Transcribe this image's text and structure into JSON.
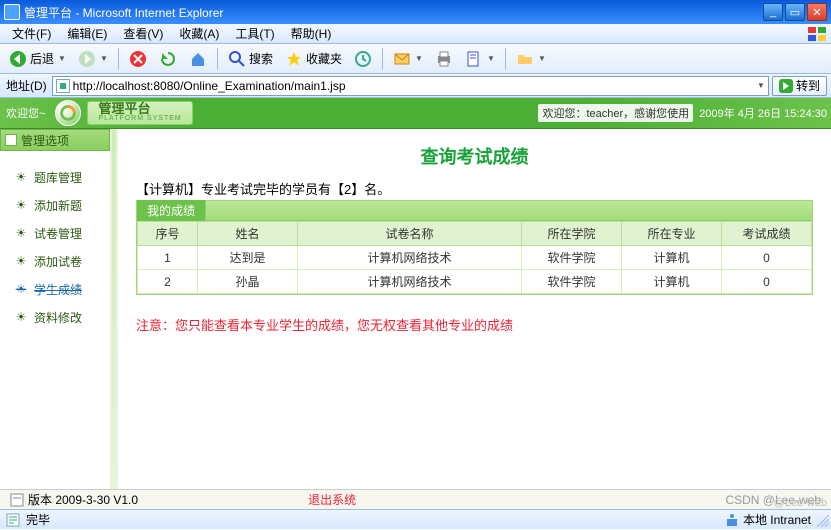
{
  "window": {
    "title": "管理平台 - Microsoft Internet Explorer",
    "min": "_",
    "max": "▭",
    "close": "✕"
  },
  "menu": [
    "文件(F)",
    "编辑(E)",
    "查看(V)",
    "收藏(A)",
    "工具(T)",
    "帮助(H)"
  ],
  "toolbar": {
    "back": "后退",
    "search": "搜索",
    "favorites": "收藏夹"
  },
  "address": {
    "label": "地址(D)",
    "url": "http://localhost:8080/Online_Examination/main1.jsp",
    "go": "转到"
  },
  "header": {
    "welcome": "欢迎您~",
    "brand": "管理平台",
    "brand_sub": "PLATFORM SYSTEM",
    "right_msg": "欢迎您：teacher，感谢您使用",
    "datetime": "2009年 4月 26日 15:24:30"
  },
  "sidebar": {
    "title": "管理选项",
    "items": [
      {
        "label": "题库管理"
      },
      {
        "label": "添加新题"
      },
      {
        "label": "试卷管理"
      },
      {
        "label": "添加试卷"
      },
      {
        "label": "学生成绩"
      },
      {
        "label": "资料修改"
      }
    ]
  },
  "content": {
    "heading": "查询考试成绩",
    "desc": "【计算机】专业考试完毕的学员有【2】名。",
    "panel_tab": "我的成绩",
    "columns": [
      "序号",
      "姓名",
      "试卷名称",
      "所在学院",
      "所在专业",
      "考试成绩"
    ],
    "rows": [
      {
        "no": "1",
        "name": "达到是",
        "paper": "计算机网络技术",
        "college": "软件学院",
        "major": "计算机",
        "score": "0"
      },
      {
        "no": "2",
        "name": "孙晶",
        "paper": "计算机网络技术",
        "college": "软件学院",
        "major": "计算机",
        "score": "0"
      }
    ],
    "note": "注意：您只能查看本专业学生的成绩，您无权查看其他专业的成绩"
  },
  "footer": {
    "version": "版本 2009-3-30 V1.0",
    "logout": "退出系统",
    "watermark1": "CSDN @Lee-web"
  },
  "status": {
    "done": "完毕",
    "zone": "本地 Intranet",
    "watermark2": "@Lee-web"
  }
}
